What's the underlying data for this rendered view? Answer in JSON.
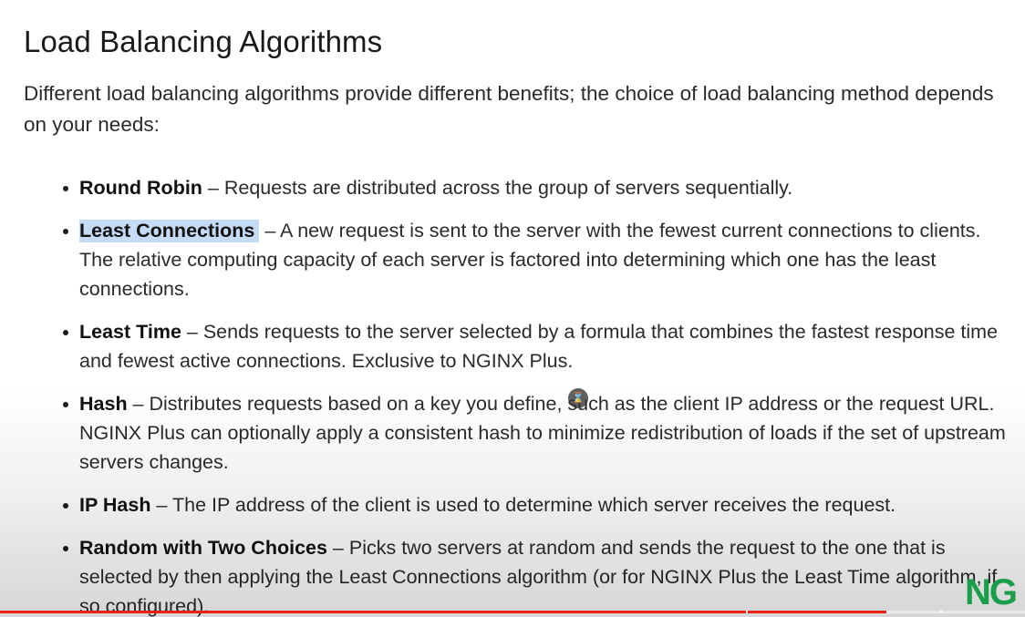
{
  "title": "Load Balancing Algorithms",
  "intro": "Different load balancing algorithms provide different benefits; the choice of load balancing method depends on your needs:",
  "items": [
    {
      "term": "Round Robin",
      "desc": " – Requests are distributed across the group of servers sequentially."
    },
    {
      "term": "Least Connections",
      "desc": " – A new request is sent to the server with the fewest current connections to clients. The relative computing capacity of each server is factored into determining which one has the least connections."
    },
    {
      "term": "Least Time",
      "desc": " – Sends requests to the server selected by a formula that combines the fastest response time and fewest active connections. Exclusive to NGINX Plus."
    },
    {
      "term": "Hash",
      "desc": " – Distributes requests based on a key you define, such as the client IP address or the request URL. NGINX Plus can optionally apply a consistent hash to minimize redistribution of loads if the set of upstream servers changes."
    },
    {
      "term": "IP Hash",
      "desc": " – The IP address of the client is used to determine which server receives the request."
    },
    {
      "term": "Random with Two Choices",
      "desc": " – Picks two servers at random and sends the request to the one that is selected by then applying the Least Connections algorithm (or for NGINX Plus the Least Time algorithm, if so configured)."
    }
  ],
  "logo_text": "NG",
  "cursor_icon": "hourglass-icon",
  "colors": {
    "highlight": "#c6dcf6",
    "progress": "#e62117",
    "logo": "#1b9e4b"
  },
  "video_progress": 0.865
}
